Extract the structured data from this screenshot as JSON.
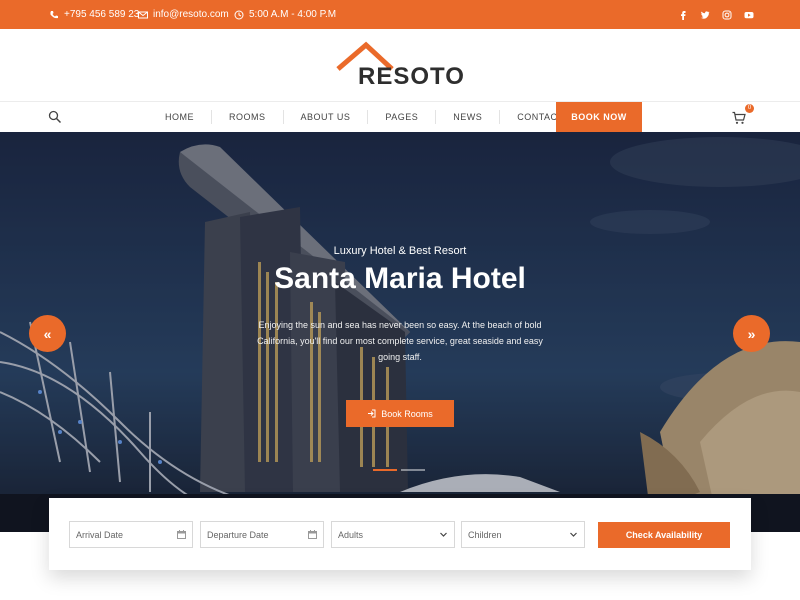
{
  "topbar": {
    "phone": "+795 456 589 23",
    "email": "info@resoto.com",
    "hours": "5:00 A.M - 4:00 P.M",
    "social": [
      "facebook-icon",
      "twitter-icon",
      "instagram-icon",
      "youtube-icon"
    ]
  },
  "logo": {
    "brand": "RESOTO"
  },
  "nav": {
    "items": [
      "HOME",
      "ROOMS",
      "ABOUT US",
      "PAGES",
      "NEWS",
      "CONTACT"
    ],
    "book_now": "BOOK NOW",
    "cart_count": "0"
  },
  "hero": {
    "subtitle": "Luxury Hotel & Best Resort",
    "title": "Santa Maria Hotel",
    "description": "Enjoying the sun and sea has never been so easy. At the beach of bold California, you'll find our most complete service, great seaside and easy going staff.",
    "cta": "Book Rooms",
    "prev_icon": "«",
    "next_icon": "»",
    "slides": 2,
    "active_slide": 1
  },
  "booking": {
    "arrival_placeholder": "Arrival Date",
    "departure_placeholder": "Departure Date",
    "adults_value": "Adults",
    "children_value": "Children",
    "check_label": "Check Availability"
  },
  "colors": {
    "accent": "#ea6a2a",
    "dark": "#2e2e2e"
  }
}
